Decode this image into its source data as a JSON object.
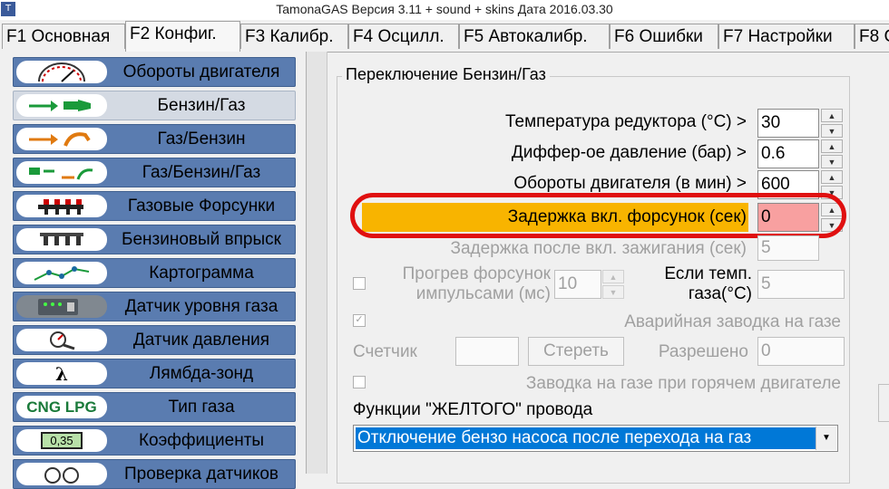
{
  "window": {
    "title": "TamonaGAS  Версия 3.11 + sound + skins  Дата 2016.03.30",
    "icon_label": "T"
  },
  "tabs": [
    {
      "label": "F1 Основная",
      "active": false
    },
    {
      "label": "F2 Конфиг.",
      "active": true
    },
    {
      "label": "F3 Калибр.",
      "active": false
    },
    {
      "label": "F4 Осцилл.",
      "active": false
    },
    {
      "label": "F5 Автокалибр.",
      "active": false
    },
    {
      "label": "F6 Ошибки",
      "active": false
    },
    {
      "label": "F7 Настройки",
      "active": false
    },
    {
      "label": "F8 С",
      "active": false
    }
  ],
  "sidebar": {
    "items": [
      {
        "label": "Обороты двигателя",
        "icon": "tachometer-icon"
      },
      {
        "label": "Бензин/Газ",
        "icon": "petrol-to-gas-icon",
        "active": true
      },
      {
        "label": "Газ/Бензин",
        "icon": "gas-to-petrol-icon"
      },
      {
        "label": "Газ/Бензин/Газ",
        "icon": "gas-petrol-gas-icon"
      },
      {
        "label": "Газовые Форсунки",
        "icon": "gas-injectors-icon"
      },
      {
        "label": "Бензиновый впрыск",
        "icon": "petrol-injection-icon"
      },
      {
        "label": "Картограмма",
        "icon": "map-graph-icon"
      },
      {
        "label": "Датчик уровня газа",
        "icon": "gas-level-sensor-icon"
      },
      {
        "label": "Датчик давления",
        "icon": "pressure-sensor-icon"
      },
      {
        "label": "Лямбда-зонд",
        "icon": "lambda-probe-icon"
      },
      {
        "label": "Тип газа",
        "icon": "gas-type-icon",
        "icon_text": "CNG LPG"
      },
      {
        "label": "Коэффициенты",
        "icon": "coefficients-icon",
        "icon_text": "0,35"
      },
      {
        "label": "Проверка датчиков",
        "icon": "sensor-check-icon"
      }
    ]
  },
  "group": {
    "title": "Переключение Бензин/Газ",
    "rows": {
      "temp": {
        "label": "Температура редуктора (°С) >",
        "value": "30"
      },
      "pressure": {
        "label": "Диффер-ое давление (бар) >",
        "value": "0.6"
      },
      "rpm": {
        "label": "Обороты  двигателя (в мин) >",
        "value": "600"
      },
      "delay": {
        "label": "Задержка вкл. форсунок (сек)",
        "value": "0"
      },
      "ign_delay": {
        "label": "Задержка после вкл. зажигания (сек)",
        "value": "5"
      }
    },
    "preheat": {
      "label_line1": "Прогрев форсунок",
      "label_line2": "импульсами (мс)",
      "value": "10"
    },
    "gas_temp": {
      "label_line1": "Если темп.",
      "label_line2": "газа(°С)",
      "value": "5"
    },
    "emergency": {
      "label": "Аварийная заводка на газе",
      "checked": true
    },
    "counter": {
      "label": "Счетчик",
      "value": "",
      "erase_label": "Стереть",
      "allowed_label": "Разрешено",
      "allowed_value": "0"
    },
    "hot_start": {
      "label": "Заводка на газе при горячем двигателе",
      "checked": false
    },
    "yellow_wire": {
      "label": "Функции \"ЖЕЛТОГО\" провода",
      "selected": "Отключение бензо насоса после перехода на газ"
    }
  },
  "colors": {
    "nav_button": "#5a7cb0",
    "highlight_yellow": "#f8b400",
    "highlight_ring": "#e01010",
    "selection_blue": "#0078d7",
    "input_error": "#f8a0a0"
  }
}
